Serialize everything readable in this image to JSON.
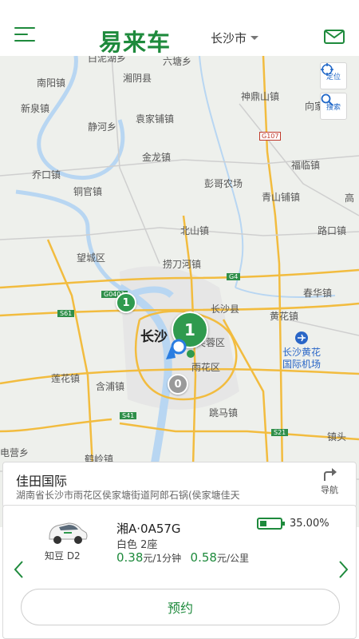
{
  "header": {
    "logo": "易来车",
    "city": "长沙市",
    "icons": {
      "menu": "menu-icon",
      "mail": "mail-icon",
      "caret": "caret-down-icon"
    }
  },
  "map": {
    "controls": {
      "locate_label": "定位",
      "search_label": "搜索"
    },
    "labels": [
      {
        "text": "白泥湖乡",
        "cls": ""
      },
      {
        "text": "六塘乡",
        "cls": ""
      },
      {
        "text": "南阳镇",
        "cls": ""
      },
      {
        "text": "湘阴县",
        "cls": ""
      },
      {
        "text": "神鼎山镇",
        "cls": ""
      },
      {
        "text": "向家",
        "cls": ""
      },
      {
        "text": "新泉镇",
        "cls": ""
      },
      {
        "text": "静河乡",
        "cls": ""
      },
      {
        "text": "袁家铺镇",
        "cls": ""
      },
      {
        "text": "金龙镇",
        "cls": ""
      },
      {
        "text": "福临镇",
        "cls": ""
      },
      {
        "text": "乔口镇",
        "cls": ""
      },
      {
        "text": "彭哥农场",
        "cls": ""
      },
      {
        "text": "铜官镇",
        "cls": ""
      },
      {
        "text": "青山铺镇",
        "cls": ""
      },
      {
        "text": "高",
        "cls": ""
      },
      {
        "text": "北山镇",
        "cls": ""
      },
      {
        "text": "路口镇",
        "cls": ""
      },
      {
        "text": "望城区",
        "cls": ""
      },
      {
        "text": "捞刀河镇",
        "cls": ""
      },
      {
        "text": "春华镇",
        "cls": ""
      },
      {
        "text": "长沙县",
        "cls": ""
      },
      {
        "text": "黄花镇",
        "cls": ""
      },
      {
        "text": "长沙",
        "cls": "big"
      },
      {
        "text": "芙蓉区",
        "cls": ""
      },
      {
        "text": "长沙黄花",
        "cls": "blue"
      },
      {
        "text": "国际机场",
        "cls": "blue"
      },
      {
        "text": "雨花区",
        "cls": ""
      },
      {
        "text": "莲花镇",
        "cls": ""
      },
      {
        "text": "含浦镇",
        "cls": ""
      },
      {
        "text": "跳马镇",
        "cls": ""
      },
      {
        "text": "镇头",
        "cls": ""
      },
      {
        "text": "电营乡",
        "cls": ""
      },
      {
        "text": "鹤岭镇",
        "cls": ""
      }
    ],
    "shields": [
      "G107",
      "G4",
      "G0401",
      "S61",
      "S41",
      "S21"
    ],
    "pins": [
      "1",
      "1",
      "0"
    ]
  },
  "location": {
    "name": "佳田国际",
    "address": "湖南省长沙市雨花区侯家塘街道阿郎石锅(侯家塘佳天",
    "nav_label": "导航"
  },
  "car": {
    "model": "知豆 D2",
    "plate": "湘A·0A57G",
    "spec": "白色 2座",
    "price_time": "0.38",
    "price_time_unit": "元/1分钟",
    "price_km": "0.58",
    "price_km_unit": "元/公里",
    "battery": "35.00%",
    "battery_level": 0.35,
    "reserve_label": "预约"
  },
  "colors": {
    "brand": "#1e8a3c",
    "river": "#b8d6f2",
    "road": "#f2bc3f",
    "link": "#1e66c7"
  }
}
